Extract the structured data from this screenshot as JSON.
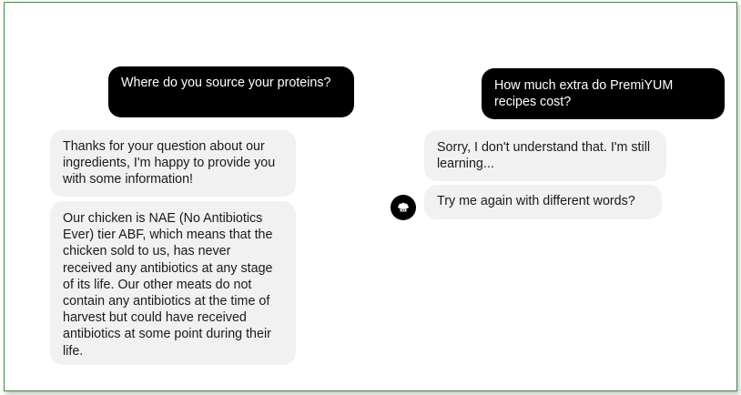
{
  "left_chat": {
    "user_message": "Where do you source your proteins?",
    "bot_messages": [
      "Thanks for your question about our ingredients, I'm happy to provide you with some information!",
      "Our chicken is NAE (No Antibiotics Ever) tier ABF, which means that the chicken sold to us, has never received any antibiotics at any stage of its life. Our other meats do not contain any antibiotics at the time of harvest but could have received antibiotics at some point during their life."
    ]
  },
  "right_chat": {
    "user_message": "How much extra do PremiYUM recipes cost?",
    "bot_messages": [
      "Sorry, I don't understand that. I'm still learning...",
      "Try me again with different words?"
    ],
    "avatar_icon": "chef-hat-icon"
  },
  "colors": {
    "user_bubble": "#000000",
    "bot_bubble": "#f1f1f1",
    "frame_border": "#4a8a4a"
  }
}
